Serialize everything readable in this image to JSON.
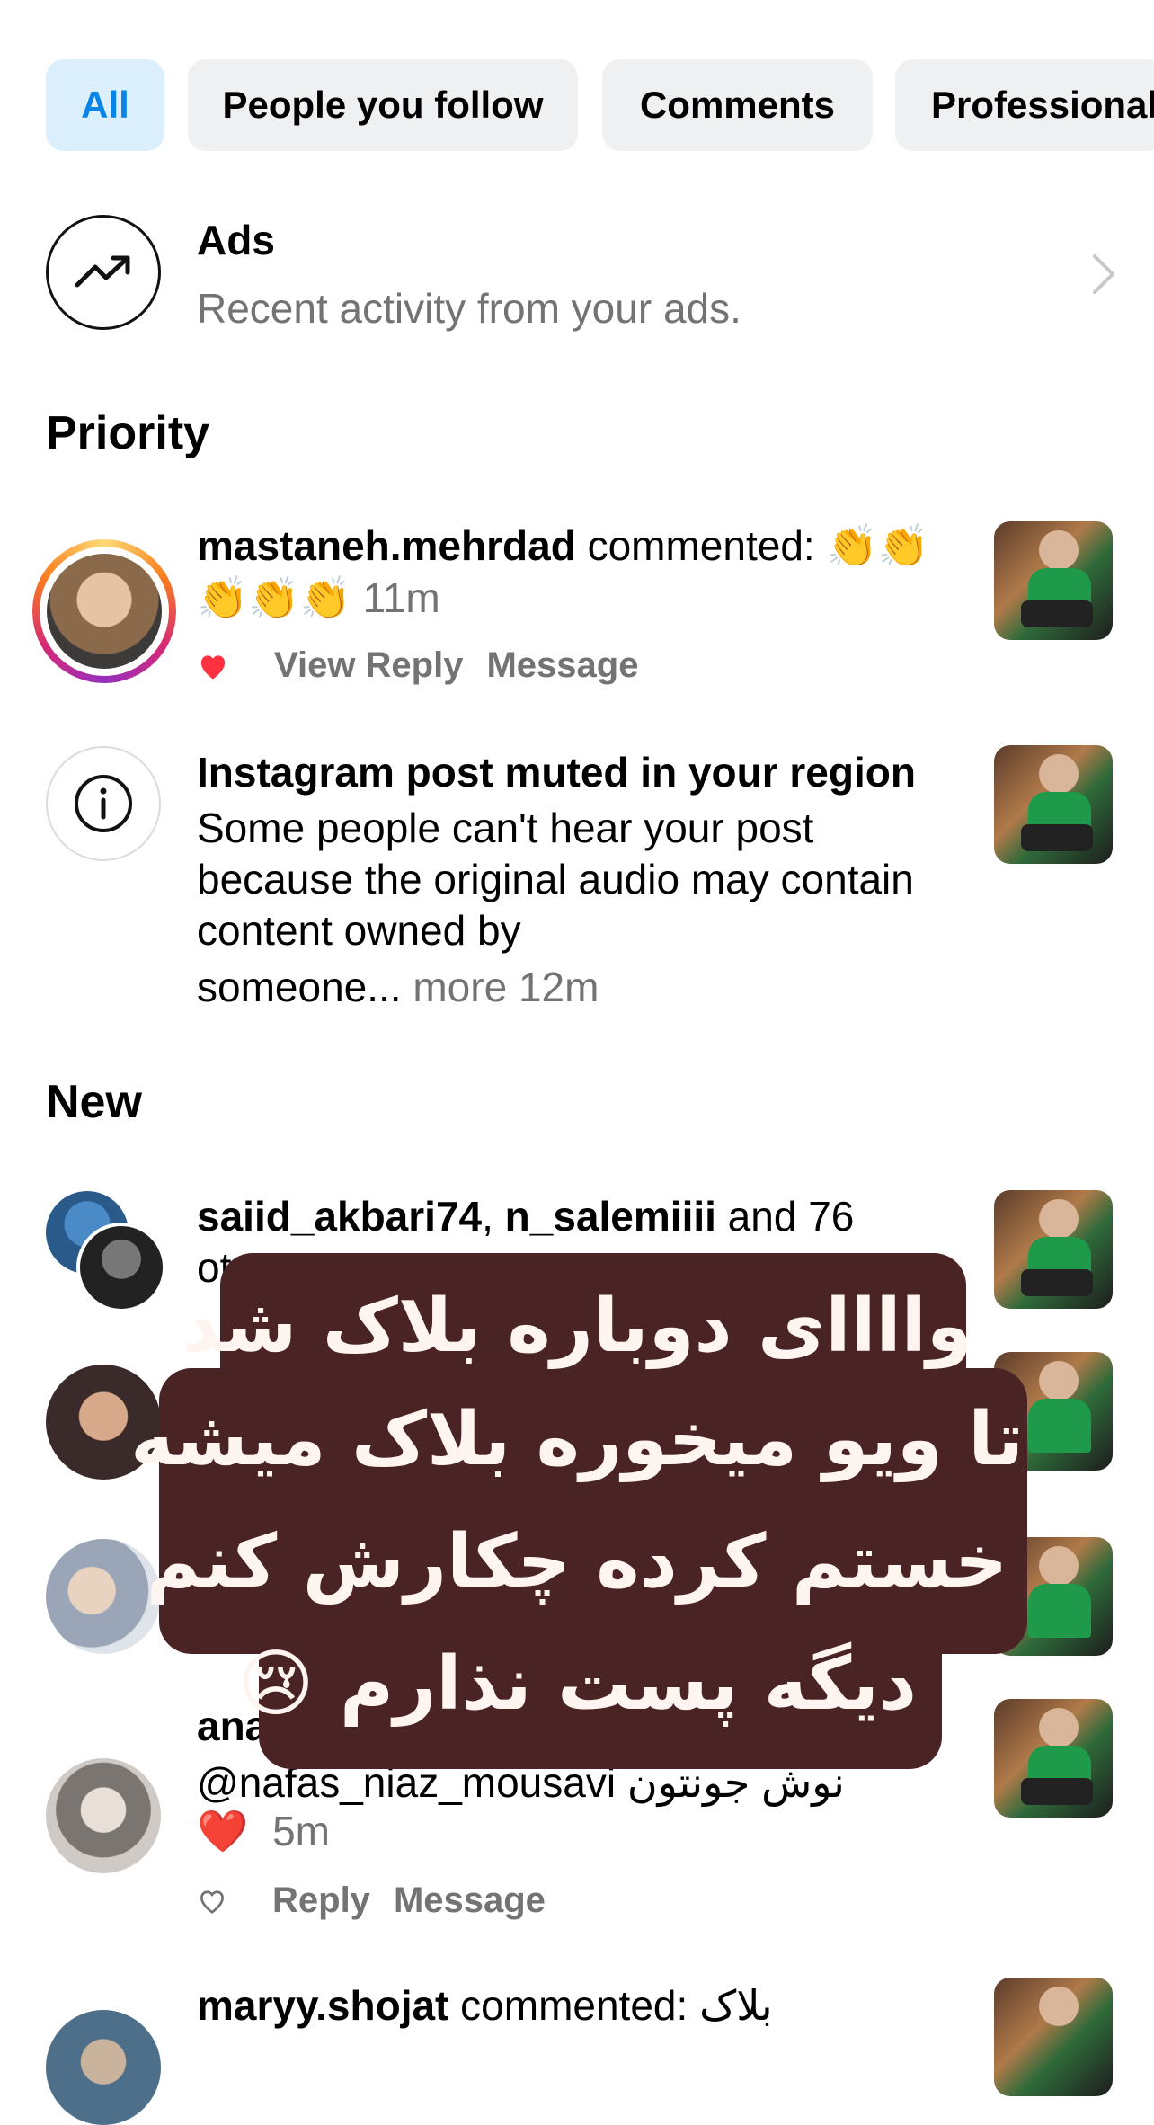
{
  "filters": [
    {
      "label": "All",
      "active": true
    },
    {
      "label": "People you follow",
      "active": false
    },
    {
      "label": "Comments",
      "active": false
    },
    {
      "label": "Professional",
      "active": false
    }
  ],
  "ads": {
    "title": "Ads",
    "subtitle": "Recent activity from your ads.",
    "icon": "trending-up-icon"
  },
  "sections": {
    "priority": "Priority",
    "new": "New"
  },
  "priority_items": [
    {
      "username": "mastaneh.mehrdad",
      "text": " commented: ",
      "emoji": "👏👏👏👏👏",
      "time": "11m",
      "actions": [
        "View Reply",
        "Message"
      ]
    },
    {
      "title": "Instagram post muted in your region",
      "body_line1": "Some people can't hear your post",
      "body_line2": "because the original audio may contain",
      "body_line3": "content owned by",
      "body_line4": "someone...",
      "more": " more",
      "time": " 12m"
    }
  ],
  "new_items": [
    {
      "user1": "saiid_akbari74",
      "sep": ", ",
      "user2": "n_salemiiii",
      "rest": " and 76",
      "line2_fragment": "ot"
    },
    {
      "user_fragment": "ana",
      "comment_line": "@nafas_niaz_mousavi نوش جونتون",
      "emoji": "❤️",
      "time": "5m",
      "actions": [
        "Reply",
        "Message"
      ]
    },
    {
      "username": "maryy.shojat",
      "text": " commented: بلاک"
    }
  ],
  "overlay": {
    "line1": "واااای دوباره بلاک شد",
    "line2": "تا ویو میخوره بلاک میشه",
    "line3": "خستم کرده چکارش کنم",
    "line4": "دیگه پست نذارم",
    "emoji": "😢"
  },
  "colors": {
    "accent_blue": "#0a84e6",
    "chip_active_bg": "#dbeffd",
    "chip_bg": "#eff0f2",
    "muted_text": "#737373",
    "heart_red": "#ff3040",
    "overlay_bg": "#4a2424"
  }
}
